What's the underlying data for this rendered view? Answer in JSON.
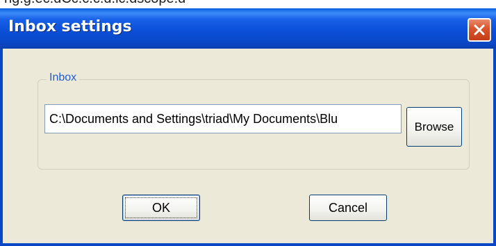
{
  "behind_text": "ng.g.ec.dCc.c.c.d.lc.dscope.d",
  "window": {
    "title": "Inbox settings"
  },
  "group": {
    "label": "Inbox"
  },
  "inbox_path": {
    "value": "C:\\Documents and Settings\\triad\\My Documents\\Blu"
  },
  "buttons": {
    "browse": "Browse",
    "ok": "OK",
    "cancel": "Cancel"
  },
  "icons": {
    "close": "close-icon"
  },
  "colors": {
    "titlebar": "#0a47c6",
    "close_button": "#d9532c",
    "dialog_bg": "#ece9d8",
    "group_label": "#1e5cd6"
  }
}
